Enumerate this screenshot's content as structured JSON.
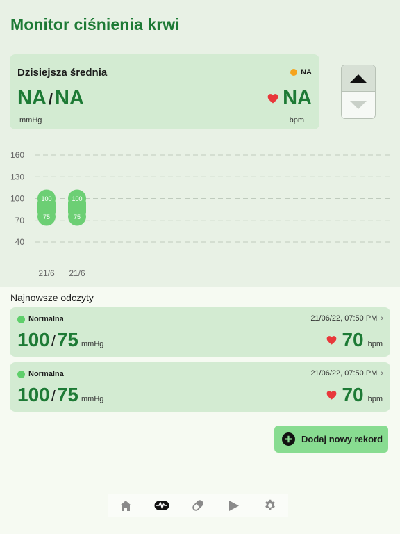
{
  "app": {
    "title": "Monitor ciśnienia krwi"
  },
  "summary": {
    "title": "Dzisiejsza średnia",
    "status": "NA",
    "systolic": "NA",
    "slash": "/",
    "diastolic": "NA",
    "bp_unit": "mmHg",
    "pulse": "NA",
    "pulse_unit": "bpm"
  },
  "colors": {
    "accent": "#1d7a35",
    "card": "#d3ebd2",
    "status_na": "#f5a41d",
    "status_normal": "#5fcf6b",
    "heart": "#e8383b",
    "chart_marker": "#6ccf74"
  },
  "chart_data": {
    "type": "bar",
    "y_ticks": [
      "160",
      "130",
      "100",
      "70",
      "40"
    ],
    "ylim": [
      40,
      160
    ],
    "grid": true,
    "categories": [
      "21/6",
      "21/6"
    ],
    "series": [
      {
        "name": "",
        "values": [
          100,
          100
        ]
      },
      {
        "name": "",
        "values": [
          75,
          75
        ]
      }
    ],
    "point_labels": [
      {
        "systolic": "100",
        "diastolic": "75"
      },
      {
        "systolic": "100",
        "diastolic": "75"
      }
    ]
  },
  "readings_section": {
    "title": "Najnowsze odczyty"
  },
  "readings": [
    {
      "status": "Normalna",
      "datetime": "21/06/22, 07:50 PM",
      "systolic": "100",
      "slash": "/",
      "diastolic": "75",
      "unit": "mmHg",
      "pulse": "70",
      "pulse_unit": "bpm"
    },
    {
      "status": "Normalna",
      "datetime": "21/06/22, 07:50 PM",
      "systolic": "100",
      "slash": "/",
      "diastolic": "75",
      "unit": "mmHg",
      "pulse": "70",
      "pulse_unit": "bpm"
    }
  ],
  "actions": {
    "add_label": "Dodaj nowy rekord"
  },
  "tabs": [
    {
      "icon": "home-icon",
      "active": false
    },
    {
      "icon": "heartbeat-icon",
      "active": true
    },
    {
      "icon": "pill-icon",
      "active": false
    },
    {
      "icon": "play-icon",
      "active": false
    },
    {
      "icon": "gear-icon",
      "active": false
    }
  ]
}
